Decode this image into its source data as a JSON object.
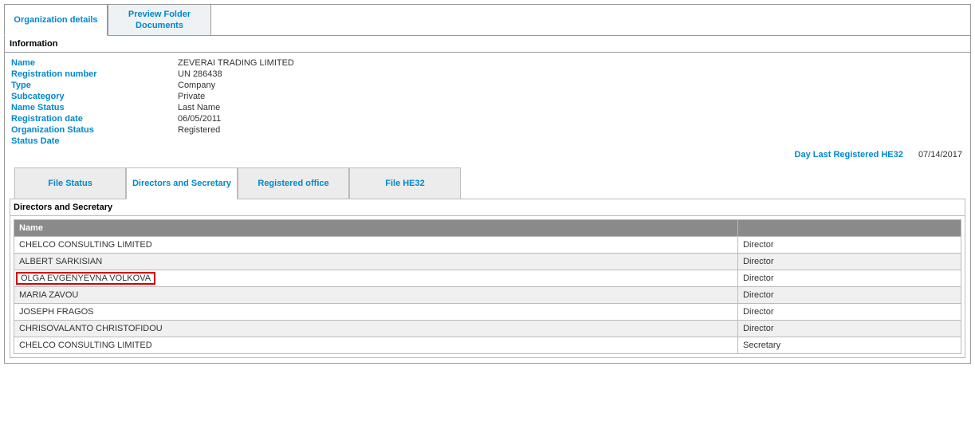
{
  "topTabs": {
    "organizationDetails": "Organization details",
    "previewFolderDocuments": "Preview Folder Documents"
  },
  "informationTitle": "Information",
  "info": {
    "nameLabel": "Name",
    "name": "ZEVERAI TRADING LIMITED",
    "regNumberLabel": "Registration number",
    "regNumber": "UN 286438",
    "typeLabel": "Type",
    "type": "Company",
    "subcategoryLabel": "Subcategory",
    "subcategory": "Private",
    "nameStatusLabel": "Name Status",
    "nameStatus": "Last Name",
    "regDateLabel": "Registration date",
    "regDate": "06/05/2011",
    "orgStatusLabel": "Organization Status",
    "orgStatus": "Registered",
    "statusDateLabel": "Status Date",
    "statusDate": ""
  },
  "he32": {
    "label": "Day Last Registered HE32",
    "date": "07/14/2017"
  },
  "subTabs": {
    "fileStatus": "File Status",
    "directorsSecretary": "Directors and Secretary",
    "registeredOffice": "Registered office",
    "fileHE32": "File HE32"
  },
  "directorsTitle": "Directors and Secretary",
  "table": {
    "headerName": "Name",
    "headerRole": "",
    "rows": [
      {
        "name": "CHELCO CONSULTING LIMITED",
        "role": "Director",
        "highlight": false
      },
      {
        "name": "ALBERT SARKISIAN",
        "role": "Director",
        "highlight": false
      },
      {
        "name": "OLGA EVGENYEVNA VOLKOVA",
        "role": "Director",
        "highlight": true
      },
      {
        "name": "MARIA ZAVOU",
        "role": "Director",
        "highlight": false
      },
      {
        "name": "JOSEPH FRAGOS",
        "role": "Director",
        "highlight": false
      },
      {
        "name": "CHRISOVALANTO CHRISTOFIDOU",
        "role": "Director",
        "highlight": false
      },
      {
        "name": "CHELCO CONSULTING LIMITED",
        "role": "Secretary",
        "highlight": false
      }
    ]
  }
}
